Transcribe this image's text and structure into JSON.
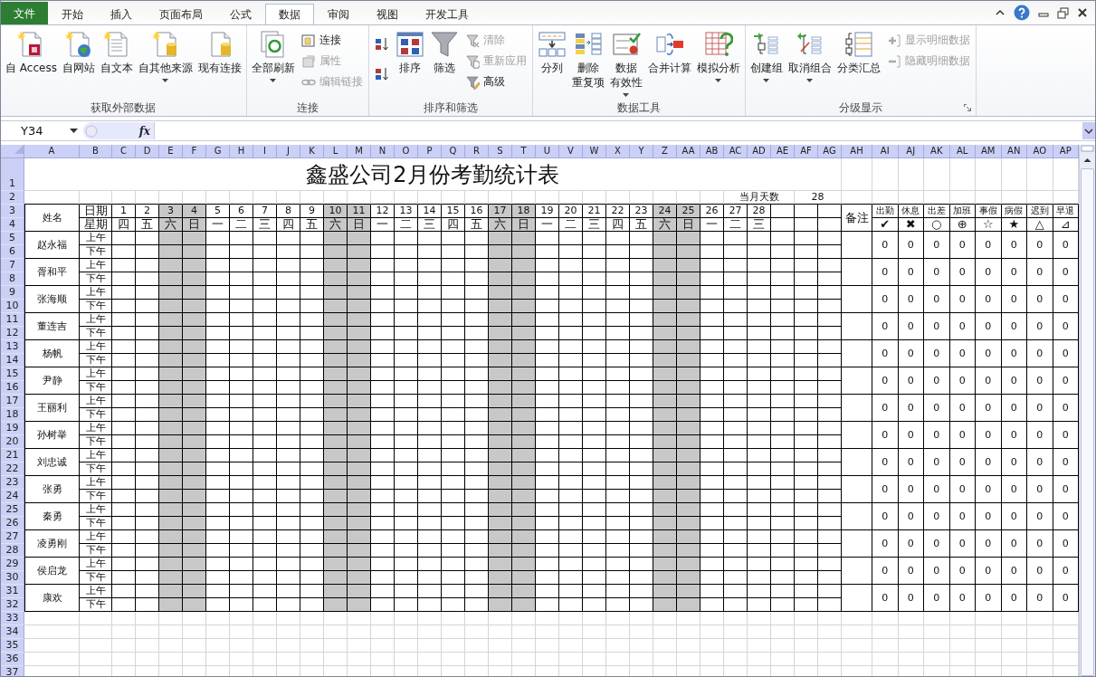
{
  "tabs": [
    {
      "label": "文件",
      "kind": "file",
      "selected": false
    },
    {
      "label": "开始",
      "kind": "tab",
      "selected": false
    },
    {
      "label": "插入",
      "kind": "tab",
      "selected": false
    },
    {
      "label": "页面布局",
      "kind": "tab",
      "selected": false
    },
    {
      "label": "公式",
      "kind": "tab",
      "selected": false
    },
    {
      "label": "数据",
      "kind": "tab",
      "selected": true
    },
    {
      "label": "审阅",
      "kind": "tab",
      "selected": false
    },
    {
      "label": "视图",
      "kind": "tab",
      "selected": false
    },
    {
      "label": "开发工具",
      "kind": "tab",
      "selected": false
    }
  ],
  "ribbon_groups": [
    {
      "label": "获取外部数据",
      "items": [
        {
          "kind": "large",
          "label": [
            "自 Access"
          ],
          "dropdown": false
        },
        {
          "kind": "large",
          "label": [
            "自网站"
          ],
          "dropdown": false
        },
        {
          "kind": "large",
          "label": [
            "自文本"
          ],
          "dropdown": false
        },
        {
          "kind": "large",
          "label": [
            "自其他来源"
          ],
          "dropdown": true
        },
        {
          "kind": "large",
          "label": [
            "现有连接"
          ],
          "dropdown": false
        }
      ]
    },
    {
      "label": "连接",
      "items": [
        {
          "kind": "large",
          "label": [
            "全部刷新"
          ],
          "dropdown": true
        },
        {
          "kind": "small",
          "label": "连接",
          "disabled": false
        },
        {
          "kind": "small",
          "label": "属性",
          "disabled": true
        },
        {
          "kind": "small",
          "label": "编辑链接",
          "disabled": true
        }
      ]
    },
    {
      "label": "排序和筛选",
      "items": [
        {
          "kind": "icon"
        },
        {
          "kind": "icon"
        },
        {
          "kind": "large",
          "label": [
            "排序"
          ],
          "dropdown": false
        },
        {
          "kind": "large",
          "label": [
            "筛选"
          ],
          "dropdown": false
        },
        {
          "kind": "small",
          "label": "清除",
          "disabled": true
        },
        {
          "kind": "small",
          "label": "重新应用",
          "disabled": true
        },
        {
          "kind": "small",
          "label": "高级",
          "disabled": false
        }
      ]
    },
    {
      "label": "数据工具",
      "items": [
        {
          "kind": "large",
          "label": [
            "分列"
          ],
          "dropdown": false
        },
        {
          "kind": "large",
          "label": [
            "删除",
            "重复项"
          ],
          "dropdown": false
        },
        {
          "kind": "large",
          "label": [
            "数据",
            "有效性"
          ],
          "dropdown": true
        },
        {
          "kind": "large",
          "label": [
            "合并计算"
          ],
          "dropdown": false
        },
        {
          "kind": "large",
          "label": [
            "模拟分析"
          ],
          "dropdown": true
        }
      ]
    },
    {
      "label": "分级显示",
      "launcher": true,
      "items": [
        {
          "kind": "large",
          "label": [
            "创建组"
          ],
          "dropdown": true
        },
        {
          "kind": "large",
          "label": [
            "取消组合"
          ],
          "dropdown": true
        },
        {
          "kind": "large",
          "label": [
            "分类汇总"
          ],
          "dropdown": false
        },
        {
          "kind": "small",
          "label": "显示明细数据",
          "disabled": true
        },
        {
          "kind": "small",
          "label": "隐藏明细数据",
          "disabled": true
        }
      ]
    }
  ],
  "formula_bar": {
    "name_box": "Y34",
    "fx": "fx"
  },
  "sheet": {
    "columns": [
      "A",
      "B",
      "C",
      "D",
      "E",
      "F",
      "G",
      "H",
      "I",
      "J",
      "K",
      "L",
      "M",
      "N",
      "O",
      "P",
      "Q",
      "R",
      "S",
      "T",
      "U",
      "V",
      "W",
      "X",
      "Y",
      "Z",
      "AA",
      "AB",
      "AC",
      "AD",
      "AE",
      "AF",
      "AG",
      "AH",
      "AI",
      "AJ",
      "AK",
      "AL",
      "AM",
      "AN",
      "AO",
      "AP"
    ],
    "row_numbers": [
      "1",
      "2",
      "3",
      "4",
      "5",
      "6",
      "7",
      "8",
      "9",
      "10",
      "11",
      "12",
      "13",
      "14",
      "15",
      "16",
      "17",
      "18",
      "19",
      "20",
      "21",
      "22",
      "23",
      "24",
      "25",
      "26",
      "27",
      "28",
      "29",
      "30",
      "31",
      "32",
      "33",
      "34",
      "35",
      "36",
      "37"
    ],
    "title": "鑫盛公司2月份考勤统计表",
    "days_label": "当月天数",
    "days_value": "28",
    "name_header": "姓名",
    "date_header": "日期",
    "weekday_header": "星期",
    "remarks_header": "备注",
    "days": [
      {
        "day": "1",
        "weekday": "四",
        "shaded": false
      },
      {
        "day": "2",
        "weekday": "五",
        "shaded": false
      },
      {
        "day": "3",
        "weekday": "六",
        "shaded": true
      },
      {
        "day": "4",
        "weekday": "日",
        "shaded": true
      },
      {
        "day": "5",
        "weekday": "一",
        "shaded": false
      },
      {
        "day": "6",
        "weekday": "二",
        "shaded": false
      },
      {
        "day": "7",
        "weekday": "三",
        "shaded": false
      },
      {
        "day": "8",
        "weekday": "四",
        "shaded": false
      },
      {
        "day": "9",
        "weekday": "五",
        "shaded": false
      },
      {
        "day": "10",
        "weekday": "六",
        "shaded": true
      },
      {
        "day": "11",
        "weekday": "日",
        "shaded": true
      },
      {
        "day": "12",
        "weekday": "一",
        "shaded": false
      },
      {
        "day": "13",
        "weekday": "二",
        "shaded": false
      },
      {
        "day": "14",
        "weekday": "三",
        "shaded": false
      },
      {
        "day": "15",
        "weekday": "四",
        "shaded": false
      },
      {
        "day": "16",
        "weekday": "五",
        "shaded": false
      },
      {
        "day": "17",
        "weekday": "六",
        "shaded": true
      },
      {
        "day": "18",
        "weekday": "日",
        "shaded": true
      },
      {
        "day": "19",
        "weekday": "一",
        "shaded": false
      },
      {
        "day": "20",
        "weekday": "二",
        "shaded": false
      },
      {
        "day": "21",
        "weekday": "三",
        "shaded": false
      },
      {
        "day": "22",
        "weekday": "四",
        "shaded": false
      },
      {
        "day": "23",
        "weekday": "五",
        "shaded": false
      },
      {
        "day": "24",
        "weekday": "六",
        "shaded": true
      },
      {
        "day": "25",
        "weekday": "日",
        "shaded": true
      },
      {
        "day": "26",
        "weekday": "一",
        "shaded": false
      },
      {
        "day": "27",
        "weekday": "二",
        "shaded": false
      },
      {
        "day": "28",
        "weekday": "三",
        "shaded": false
      }
    ],
    "summary_columns": [
      {
        "label": "出勤",
        "symbol": "✔"
      },
      {
        "label": "休息",
        "symbol": "✖"
      },
      {
        "label": "出差",
        "symbol": "○"
      },
      {
        "label": "加班",
        "symbol": "⊕"
      },
      {
        "label": "事假",
        "symbol": "☆"
      },
      {
        "label": "病假",
        "symbol": "★"
      },
      {
        "label": "迟到",
        "symbol": "△"
      },
      {
        "label": "早退",
        "symbol": "⊿"
      }
    ],
    "employees": [
      {
        "name": "赵永福",
        "am": "上午",
        "pm": "下午",
        "counts": [
          "0",
          "0",
          "0",
          "0",
          "0",
          "0",
          "0",
          "0"
        ]
      },
      {
        "name": "胥和平",
        "am": "上午",
        "pm": "下午",
        "counts": [
          "0",
          "0",
          "0",
          "0",
          "0",
          "0",
          "0",
          "0"
        ]
      },
      {
        "name": "张海顺",
        "am": "上午",
        "pm": "下午",
        "counts": [
          "0",
          "0",
          "0",
          "0",
          "0",
          "0",
          "0",
          "0"
        ]
      },
      {
        "name": "董连吉",
        "am": "上午",
        "pm": "下午",
        "counts": [
          "0",
          "0",
          "0",
          "0",
          "0",
          "0",
          "0",
          "0"
        ]
      },
      {
        "name": "杨帆",
        "am": "上午",
        "pm": "下午",
        "counts": [
          "0",
          "0",
          "0",
          "0",
          "0",
          "0",
          "0",
          "0"
        ]
      },
      {
        "name": "尹静",
        "am": "上午",
        "pm": "下午",
        "counts": [
          "0",
          "0",
          "0",
          "0",
          "0",
          "0",
          "0",
          "0"
        ]
      },
      {
        "name": "王丽利",
        "am": "上午",
        "pm": "下午",
        "counts": [
          "0",
          "0",
          "0",
          "0",
          "0",
          "0",
          "0",
          "0"
        ]
      },
      {
        "name": "孙树举",
        "am": "上午",
        "pm": "下午",
        "counts": [
          "0",
          "0",
          "0",
          "0",
          "0",
          "0",
          "0",
          "0"
        ]
      },
      {
        "name": "刘忠诚",
        "am": "上午",
        "pm": "下午",
        "counts": [
          "0",
          "0",
          "0",
          "0",
          "0",
          "0",
          "0",
          "0"
        ]
      },
      {
        "name": "张勇",
        "am": "上午",
        "pm": "下午",
        "counts": [
          "0",
          "0",
          "0",
          "0",
          "0",
          "0",
          "0",
          "0"
        ]
      },
      {
        "name": "秦勇",
        "am": "上午",
        "pm": "下午",
        "counts": [
          "0",
          "0",
          "0",
          "0",
          "0",
          "0",
          "0",
          "0"
        ]
      },
      {
        "name": "凌勇刚",
        "am": "上午",
        "pm": "下午",
        "counts": [
          "0",
          "0",
          "0",
          "0",
          "0",
          "0",
          "0",
          "0"
        ]
      },
      {
        "name": "侯启龙",
        "am": "上午",
        "pm": "下午",
        "counts": [
          "0",
          "0",
          "0",
          "0",
          "0",
          "0",
          "0",
          "0"
        ]
      },
      {
        "name": "康欢",
        "am": "上午",
        "pm": "下午",
        "counts": [
          "0",
          "0",
          "0",
          "0",
          "0",
          "0",
          "0",
          "0"
        ]
      }
    ]
  }
}
